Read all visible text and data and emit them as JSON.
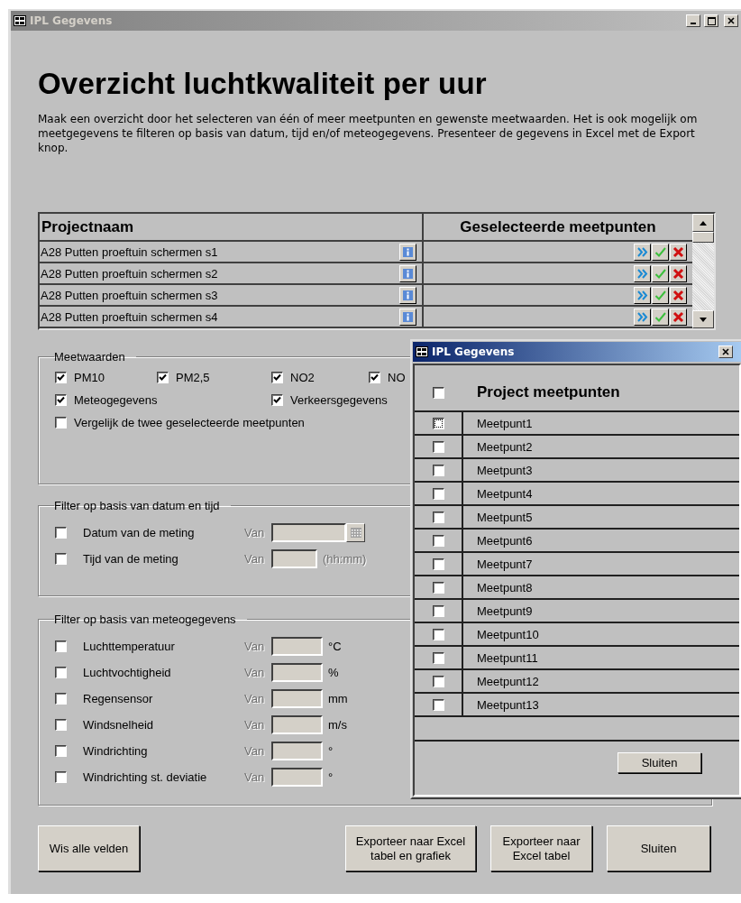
{
  "window": {
    "title": "IPL Gegevens"
  },
  "heading": "Overzicht luchtkwaliteit per uur",
  "intro": "Maak een overzicht door het selecteren van één of meer meetpunten en gewenste meetwaarden. Het is ook mogelijk om meetgegevens te filteren op basis van datum, tijd en/of meteogegevens. Presenteer de gegevens in Excel met de Export knop.",
  "projects": {
    "columns": [
      "Projectnaam",
      "Geselecteerde meetpunten"
    ],
    "rows": [
      {
        "name": "A28 Putten proeftuin schermen s1"
      },
      {
        "name": "A28 Putten proeftuin schermen s2"
      },
      {
        "name": "A28 Putten proeftuin schermen s3"
      },
      {
        "name": "A28 Putten proeftuin schermen s4"
      }
    ]
  },
  "meetwaarden": {
    "title": "Meetwaarden",
    "rows": [
      [
        {
          "label": "PM10",
          "checked": true
        },
        {
          "label": "PM2,5",
          "checked": true
        },
        {
          "label": "NO2",
          "checked": true
        },
        {
          "label": "NO",
          "checked": true
        }
      ],
      [
        {
          "label": "Meteogegevens",
          "checked": true
        },
        null,
        {
          "label": "Verkeersgegevens",
          "checked": true
        }
      ],
      [
        {
          "label": "Vergelijk de twee geselecteerde meetpunten",
          "checked": false
        }
      ]
    ]
  },
  "date_filter": {
    "title": "Filter op basis van datum en tijd",
    "rows": [
      {
        "kind": "date",
        "label": "Datum van de meting",
        "checked": false,
        "from": "Van"
      },
      {
        "kind": "time",
        "label": "Tijd van de meting",
        "checked": false,
        "from": "Van",
        "unit": "(hh:mm)"
      }
    ]
  },
  "meteo_filter": {
    "title": "Filter op basis van meteogegevens",
    "rows": [
      {
        "label": "Luchttemperatuur",
        "checked": false,
        "from": "Van",
        "unit": "°C"
      },
      {
        "label": "Luchtvochtigheid",
        "checked": false,
        "from": "Van",
        "unit": "%"
      },
      {
        "label": "Regensensor",
        "checked": false,
        "from": "Van",
        "unit": "mm"
      },
      {
        "label": "Windsnelheid",
        "checked": false,
        "from": "Van",
        "unit": "m/s"
      },
      {
        "label": "Windrichting",
        "checked": false,
        "from": "Van",
        "unit": "°"
      },
      {
        "label": "Windrichting st. deviatie",
        "checked": false,
        "from": "Van",
        "unit": "°"
      }
    ]
  },
  "buttons": [
    {
      "label": "Wis alle velden"
    },
    {
      "label": "Exporteer naar Excel\ntabel en grafiek"
    },
    {
      "label": "Exporteer naar\nExcel tabel"
    },
    {
      "label": "Sluiten"
    }
  ],
  "dialog": {
    "title": "IPL Gegevens",
    "header": {
      "label": "Project meetpunten",
      "checked": false
    },
    "items": [
      {
        "label": "Meetpunt1",
        "checked": false,
        "focused": true
      },
      {
        "label": "Meetpunt2",
        "checked": false,
        "focused": false
      },
      {
        "label": "Meetpunt3",
        "checked": false,
        "focused": false
      },
      {
        "label": "Meetpunt4",
        "checked": false,
        "focused": false
      },
      {
        "label": "Meetpunt5",
        "checked": false,
        "focused": false
      },
      {
        "label": "Meetpunt6",
        "checked": false,
        "focused": false
      },
      {
        "label": "Meetpunt7",
        "checked": false,
        "focused": false
      },
      {
        "label": "Meetpunt8",
        "checked": false,
        "focused": false
      },
      {
        "label": "Meetpunt9",
        "checked": false,
        "focused": false
      },
      {
        "label": "Meetpunt10",
        "checked": false,
        "focused": false
      },
      {
        "label": "Meetpunt11",
        "checked": false,
        "focused": false
      },
      {
        "label": "Meetpunt12",
        "checked": false,
        "focused": false
      },
      {
        "label": "Meetpunt13",
        "checked": false,
        "focused": false
      }
    ],
    "button": "Sluiten"
  }
}
